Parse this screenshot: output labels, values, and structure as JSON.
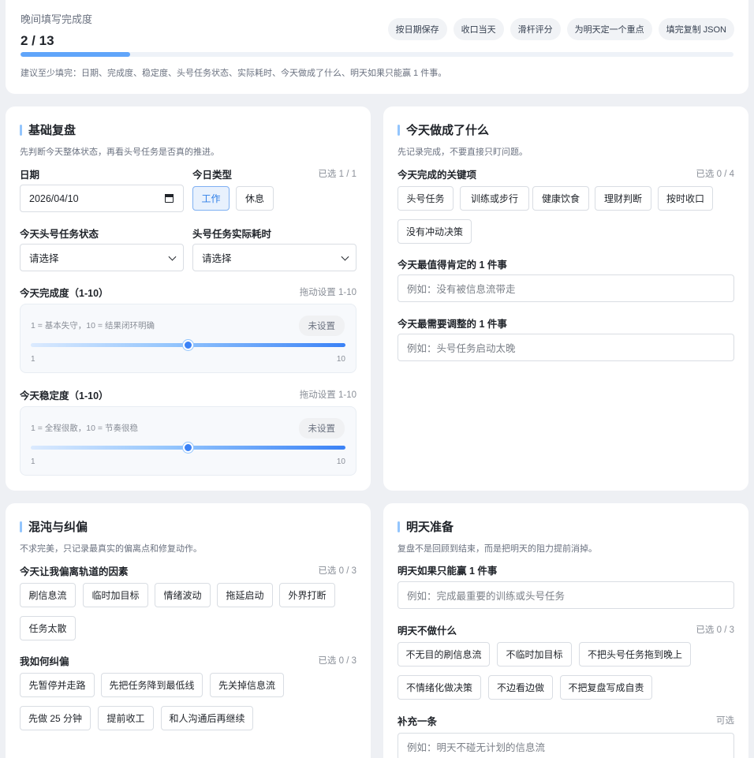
{
  "progress": {
    "title": "晚间填写完成度",
    "count_text": "2 / 13",
    "fraction": 0.154,
    "chips": [
      "按日期保存",
      "收口当天",
      "滑杆评分",
      "为明天定一个重点",
      "填完复制 JSON"
    ],
    "hint": "建议至少填完：日期、完成度、稳定度、头号任务状态、实际耗时、今天做成了什么、明天如果只能赢 1 件事。"
  },
  "basic": {
    "title": "基础复盘",
    "subtitle": "先判断今天整体状态，再看头号任务是否真的推进。",
    "date_label": "日期",
    "date_value": "2026/04/10",
    "daytype_label": "今日类型",
    "daytype_count": "已选 1 / 1",
    "daytype_options": [
      "工作",
      "休息"
    ],
    "task_status_label": "今天头号任务状态",
    "task_status_value": "请选择",
    "task_time_label": "头号任务实际耗时",
    "task_time_value": "请选择",
    "completion": {
      "label": "今天完成度（1-10）",
      "hint": "拖动设置 1-10",
      "desc": "1 = 基本失守，10 = 结果闭环明确",
      "status": "未设置",
      "min": "1",
      "max": "10",
      "level": 5.5
    },
    "stability": {
      "label": "今天稳定度（1-10）",
      "hint": "拖动设置 1-10",
      "desc": "1 = 全程很散，10 = 节奏很稳",
      "status": "未设置",
      "min": "1",
      "max": "10",
      "level": 5.5
    }
  },
  "done": {
    "title": "今天做成了什么",
    "subtitle": "先记录完成，不要直接只盯问题。",
    "key_label": "今天完成的关键项",
    "key_count": "已选 0 / 4",
    "key_options": [
      "头号任务",
      "训练或步行",
      "健康饮食",
      "理财判断",
      "按时收口",
      "没有冲动决策"
    ],
    "best_label": "今天最值得肯定的 1 件事",
    "best_placeholder": "例如：没有被信息流带走",
    "adjust_label": "今天最需要调整的 1 件事",
    "adjust_placeholder": "例如：头号任务启动太晚"
  },
  "chaos": {
    "title": "混沌与纠偏",
    "subtitle": "不求完美，只记录最真实的偏离点和修复动作。",
    "factors_label": "今天让我偏离轨道的因素",
    "factors_count": "已选 0 / 3",
    "factors": [
      "刷信息流",
      "临时加目标",
      "情绪波动",
      "拖延启动",
      "外界打断",
      "任务太散"
    ],
    "fix_label": "我如何纠偏",
    "fix_count": "已选 0 / 3",
    "fixes": [
      "先暂停并走路",
      "先把任务降到最低线",
      "先关掉信息流",
      "先做 25 分钟",
      "提前收工",
      "和人沟通后再继续"
    ]
  },
  "tomorrow": {
    "title": "明天准备",
    "subtitle": "复盘不是回顾到结束，而是把明天的阻力提前消掉。",
    "win_label": "明天如果只能赢 1 件事",
    "win_placeholder": "例如：完成最重要的训练或头号任务",
    "dont_label": "明天不做什么",
    "dont_count": "已选 0 / 3",
    "dont_options": [
      "不无目的刷信息流",
      "不临时加目标",
      "不把头号任务拖到晚上",
      "不情绪化做决策",
      "不边看边做",
      "不把复盘写成自责"
    ],
    "extra_label": "补充一条",
    "extra_optional": "可选",
    "extra_placeholder": "例如：明天不碰无计划的信息流"
  }
}
